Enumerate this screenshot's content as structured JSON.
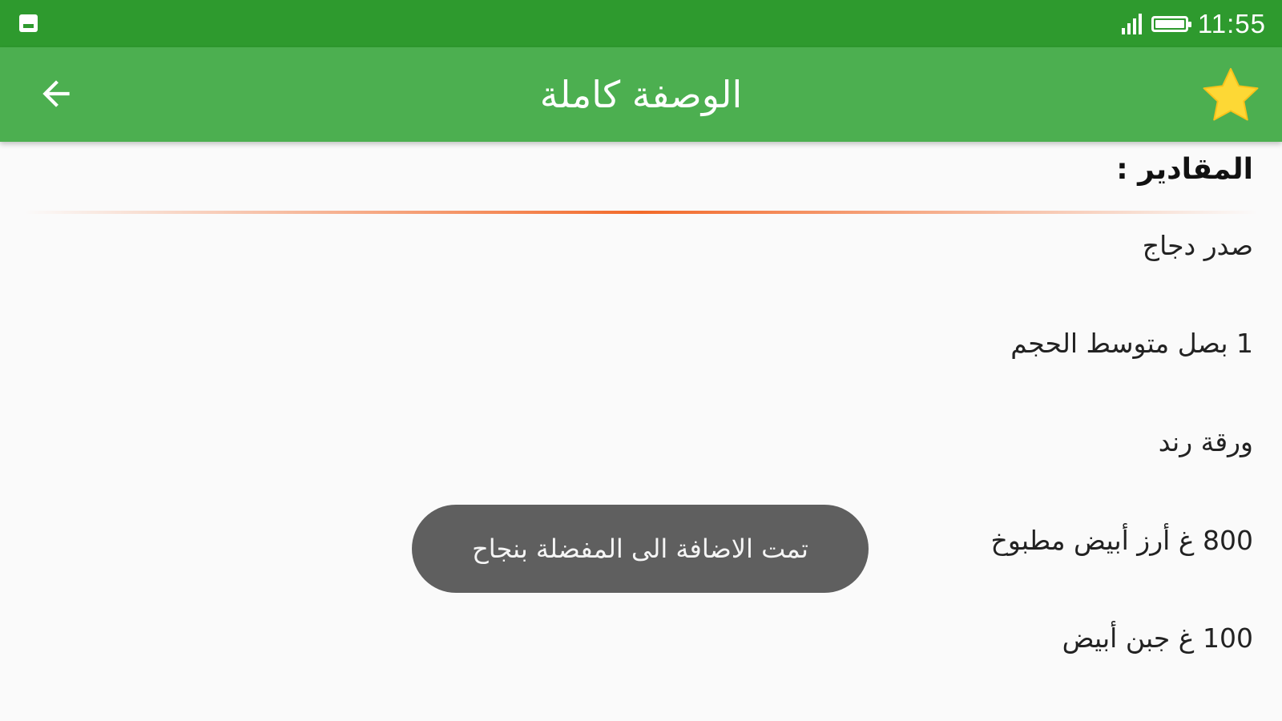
{
  "status_bar": {
    "time": "11:55",
    "icons": [
      "image-notification-icon",
      "signal-icon",
      "battery-icon"
    ],
    "background": "#2e9a2e"
  },
  "app_bar": {
    "title": "الوصفة كاملة",
    "back_icon": "arrow-left-icon",
    "favorite_icon": "star-icon",
    "background": "#4caf50",
    "favorite_color": "#fdd835"
  },
  "ingredients": {
    "heading": "المقادير :",
    "divider_color": "#f26a2a",
    "items": [
      "صدر دجاج",
      "1 بصل متوسط الحجم",
      "ورقة رند",
      "800 غ أرز أبيض مطبوخ",
      "100 غ جبن أبيض"
    ]
  },
  "toast": {
    "message": "تمت الاضافة الى المفضلة بنجاح"
  }
}
